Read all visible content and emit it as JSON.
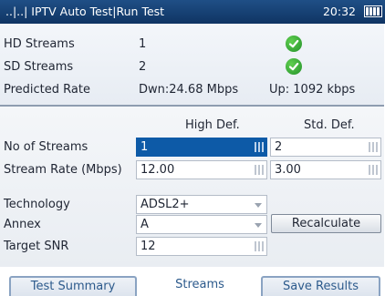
{
  "titlebar": {
    "title": "..|..| IPTV Auto Test|Run Test",
    "time": "20:32"
  },
  "summary": {
    "rows": [
      {
        "label": "HD Streams",
        "value": "1",
        "status": "pass"
      },
      {
        "label": "SD Streams",
        "value": "2",
        "status": "pass"
      },
      {
        "label": "Predicted Rate",
        "down": "Dwn:24.68 Mbps",
        "up": "Up: 1092 kbps"
      }
    ]
  },
  "table": {
    "col_hd": "High Def.",
    "col_sd": "Std. Def.",
    "no_of_streams": {
      "label": "No of Streams",
      "hd": "1",
      "sd": "2"
    },
    "stream_rate": {
      "label": "Stream Rate (Mbps)",
      "hd": "12.00",
      "sd": "3.00"
    }
  },
  "settings": {
    "technology": {
      "label": "Technology",
      "value": "ADSL2+"
    },
    "annex": {
      "label": "Annex",
      "value": "A"
    },
    "target_snr": {
      "label": "Target SNR",
      "value": "12"
    },
    "recalculate_label": "Recalculate"
  },
  "tabs": [
    {
      "label": "Test Summary"
    },
    {
      "label": "Streams",
      "selected": true
    },
    {
      "label": "Save Results"
    }
  ],
  "colors": {
    "titlebar": "#0f3463",
    "selected_field": "#0d5aa7",
    "pass_green": "#23912a",
    "tab_text": "#2c5a8c"
  },
  "icons": [
    "battery-icon",
    "check-icon",
    "keypad-icon",
    "dropdown-arrow-icon"
  ]
}
